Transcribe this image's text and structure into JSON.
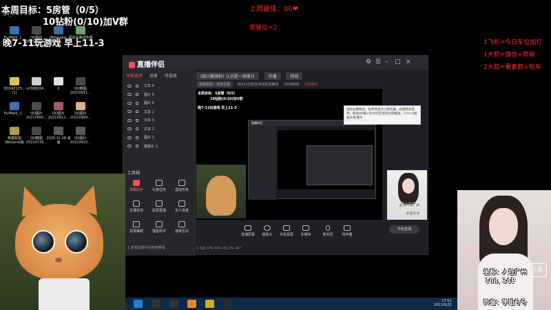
{
  "overlay": {
    "goal_line1": "本周目标：5房管（0/5）",
    "goal_line2": "10钻粉(0/10)加V群",
    "goal_line3": "晚7-11玩游戏 早上11-3",
    "tiny_user": "@a_oris... 5:8",
    "red_top1": "上周最佳：80❤",
    "red_top2": "房管位=2",
    "right_notes": [
      "1飞机=今日车位加打",
      "1大箭=微信+房管",
      "2大箭=看素颜+包车"
    ]
  },
  "desktop_icons": [
    {
      "label": "FurMark_1...",
      "color": "#3b6fb6"
    },
    {
      "label": "QQ图片20210905...",
      "color": "#4c4c4c"
    },
    {
      "label": "Wallpaper Engine：...",
      "color": "#3c6ea0"
    },
    {
      "label": "驱动总裁绿色版",
      "color": "#6fa36c"
    },
    {
      "label": "DG542125... (1)",
      "color": "#e3c34e"
    },
    {
      "label": "sn588034...",
      "color": "#cfcfcf"
    },
    {
      "label": "0",
      "color": "#e0e0e0"
    },
    {
      "label": "QQ截图20210911...",
      "color": "#4a4a4a"
    },
    {
      "label": "FurMark_1...",
      "color": "#3b6fb6"
    },
    {
      "label": "QQ图片20210905...",
      "color": "#4c4c4c"
    },
    {
      "label": "QQ图片20210912...",
      "color": "#a05b6b"
    },
    {
      "label": "QQ图片20210909...",
      "color": "#d6b38a"
    },
    {
      "label": "英雄联盟WeGame版",
      "color": "#b59a4a"
    },
    {
      "label": "QQ截图20210728...",
      "color": "#4a4a4a"
    },
    {
      "label": "2020.11.28 桌面",
      "color": "#5a5a5a"
    },
    {
      "label": "QQ图片20210922...",
      "color": "#5a5a5a"
    }
  ],
  "app": {
    "title": "直播伴侣",
    "sidebar_tabs": [
      "场景选项",
      "场景",
      "可选项"
    ],
    "layers": [
      "文本 4",
      "图片 5",
      "图片 4",
      "文本 1",
      "文本 3",
      "文本 2",
      "图片 1",
      "摄像头 1"
    ],
    "tools_title": "工具箱",
    "tools": [
      {
        "label": "弹幕助手",
        "red": true
      },
      {
        "label": "礼物任务",
        "red": false
      },
      {
        "label": "虚拟形象",
        "red": false
      },
      {
        "label": "主播任务",
        "red": false
      },
      {
        "label": "投屏直播",
        "red": false
      },
      {
        "label": "多人连麦",
        "red": false
      },
      {
        "label": "滤镜美颜",
        "red": false
      },
      {
        "label": "福星助手",
        "red": false
      },
      {
        "label": "游戏互动",
        "red": false
      }
    ],
    "sidebar_footer": "1.查看直播伴侣使用教程",
    "toolbar": {
      "title_pill": "(四川酸辣粉) 认识是一场缘分",
      "btn1": "开播",
      "btn2": "特效"
    },
    "infobar": {
      "pill1": "高级联盟：传统主题",
      "text1": "16921位粉丝共创的直播间",
      "num1": "1009686",
      "num2": "132410"
    },
    "preview_lines": [
      "本周目标：5房管（0/5）",
      "10钻粉(0/10)加V群",
      "晚7-11玩游戏 早上11-3"
    ],
    "tooltip": "鼠标左键拖动，拉伸改变大小和位置，右键更多菜单，按住Alt键+Shift可实现等比例缩放，Ctrl+V粘贴文本/图片",
    "bottom_buttons": [
      "直播屏幕",
      "摄像头",
      "手机投屏",
      "多媒体",
      "麦克风",
      "扬声器"
    ],
    "start_live": "开始直播",
    "statusbar": "5 5帧 CPU 46%  65.2%  96°"
  },
  "girl": {
    "line1": "坐标：人在广州",
    "line2": "168, 34F",
    "line3": "抖音：学姐兮兮",
    "badge": "三国",
    "small_line1": "坐标人在广州",
    "small_line2": "学姐兮兮"
  },
  "taskbar": {
    "icons": [
      {
        "name": "k-app",
        "color": "#2e7bd6"
      },
      {
        "name": "obs-app",
        "color": "#333333"
      },
      {
        "name": "obs-app-2",
        "color": "#333333"
      },
      {
        "name": "orange-app",
        "color": "#e08a2e"
      },
      {
        "name": "bilibili-app",
        "color": "#d4a62a"
      },
      {
        "name": "lol-app",
        "color": "#2a2a2a"
      }
    ],
    "time": "17:52",
    "date": "2021/9/25"
  }
}
